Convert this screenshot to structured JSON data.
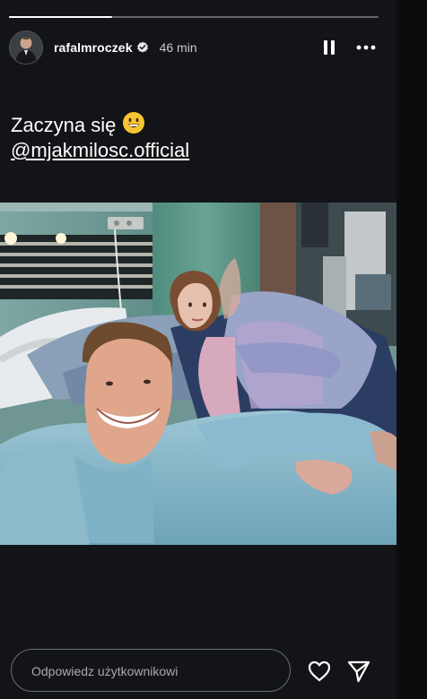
{
  "story": {
    "progress": 0.28,
    "username": "rafalmroczek",
    "time_ago": "46 min",
    "caption_line1": "Zaczyna się",
    "caption_line2": "@mjakmilosc.official"
  },
  "reply": {
    "placeholder": "Odpowiedz użytkownikowi"
  },
  "icons": [
    "verified-badge-icon",
    "pause-icon",
    "more-options-icon",
    "grinning-emoji-icon",
    "heart-icon",
    "send-icon"
  ],
  "colors": {
    "background": "#121417",
    "text": "#ffffff",
    "muted": "#c8c8c8",
    "outline": "#6a6d72"
  }
}
